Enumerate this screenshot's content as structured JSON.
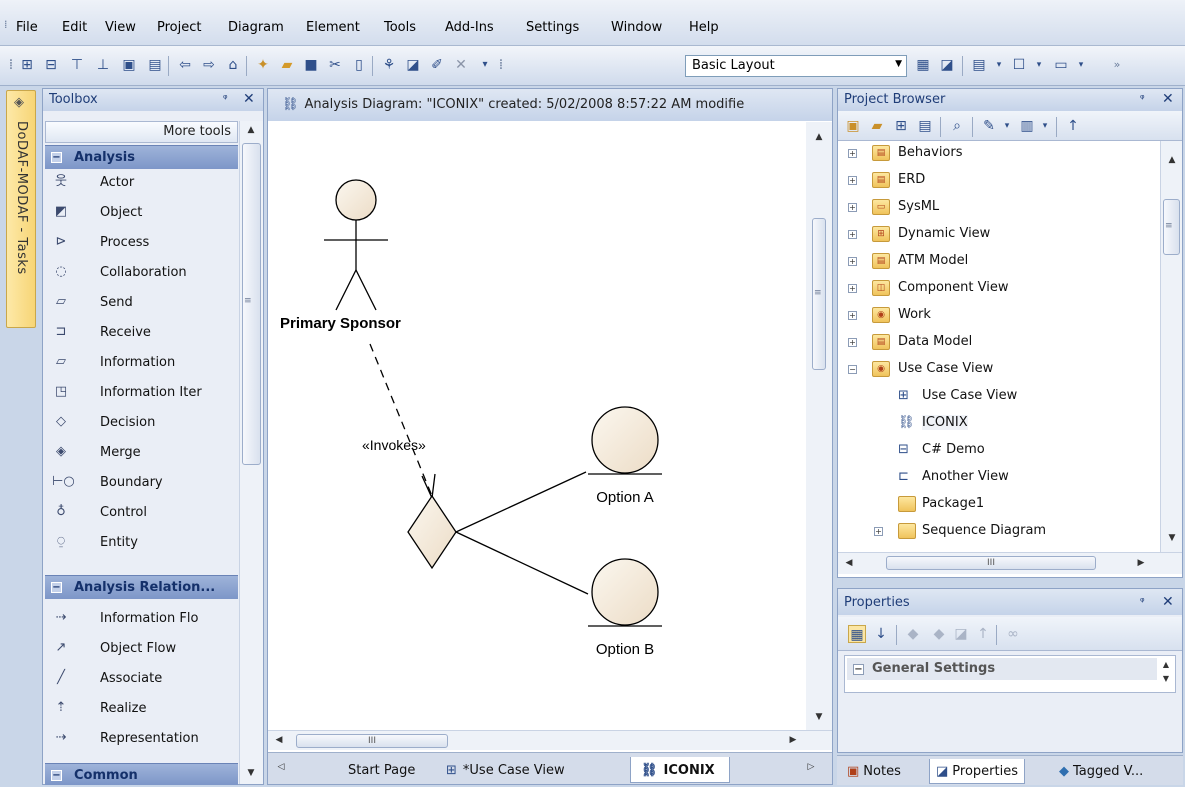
{
  "menubar": {
    "items": [
      "File",
      "Edit",
      "View",
      "Project",
      "Diagram",
      "Element",
      "Tools",
      "Add-Ins",
      "Settings",
      "Window",
      "Help"
    ]
  },
  "toolbar": {
    "layout_value": "Basic Layout"
  },
  "dock_tab": {
    "label": "DoDAF-MODAF - Tasks"
  },
  "toolbox": {
    "title": "Toolbox",
    "more_tools": "More tools",
    "groups": [
      {
        "label": "Analysis"
      },
      {
        "label": "Analysis Relation..."
      },
      {
        "label": "Common"
      }
    ],
    "analysis_items": [
      {
        "label": "Actor",
        "icon": "actor-icon"
      },
      {
        "label": "Object",
        "icon": "object-icon"
      },
      {
        "label": "Process",
        "icon": "process-icon"
      },
      {
        "label": "Collaboration",
        "icon": "collaboration-icon"
      },
      {
        "label": "Send",
        "icon": "send-icon"
      },
      {
        "label": "Receive",
        "icon": "receive-icon"
      },
      {
        "label": "Information",
        "icon": "information-icon"
      },
      {
        "label": "Information Iter",
        "icon": "information-item-icon"
      },
      {
        "label": "Decision",
        "icon": "decision-icon"
      },
      {
        "label": "Merge",
        "icon": "merge-icon"
      },
      {
        "label": "Boundary",
        "icon": "boundary-icon"
      },
      {
        "label": "Control",
        "icon": "control-icon"
      },
      {
        "label": "Entity",
        "icon": "entity-icon"
      }
    ],
    "relation_items": [
      {
        "label": "Information Flo",
        "icon": "information-flow-icon"
      },
      {
        "label": "Object Flow",
        "icon": "object-flow-icon"
      },
      {
        "label": "Associate",
        "icon": "associate-icon"
      },
      {
        "label": "Realize",
        "icon": "realize-icon"
      },
      {
        "label": "Representation",
        "icon": "representation-icon"
      }
    ]
  },
  "diagram": {
    "title": "Analysis Diagram: \"ICONIX\"   created: 5/02/2008 8:57:22 AM  modifie",
    "actor_label": "Primary Sponsor",
    "connector_label": "«Invokes»",
    "entity_a": "Option A",
    "entity_b": "Option B",
    "tabs": [
      {
        "label": "Start Page"
      },
      {
        "label": "*Use Case View"
      },
      {
        "label": "ICONIX"
      }
    ],
    "scroll_glyph": "III"
  },
  "project_browser": {
    "title": "Project Browser",
    "tree": [
      {
        "label": "Behaviors"
      },
      {
        "label": "ERD"
      },
      {
        "label": "SysML"
      },
      {
        "label": "Dynamic View"
      },
      {
        "label": "ATM Model"
      },
      {
        "label": "Component View"
      },
      {
        "label": "Work"
      },
      {
        "label": "Data Model"
      },
      {
        "label": "Use Case View"
      },
      {
        "label": "Use Case View"
      },
      {
        "label": "ICONIX"
      },
      {
        "label": "C# Demo"
      },
      {
        "label": "Another View"
      },
      {
        "label": "Package1"
      },
      {
        "label": "Sequence Diagram"
      }
    ]
  },
  "properties": {
    "title": "Properties",
    "group": "General Settings"
  },
  "bottom_tabs": [
    {
      "label": "Notes"
    },
    {
      "label": "Properties"
    },
    {
      "label": "Tagged V..."
    }
  ]
}
